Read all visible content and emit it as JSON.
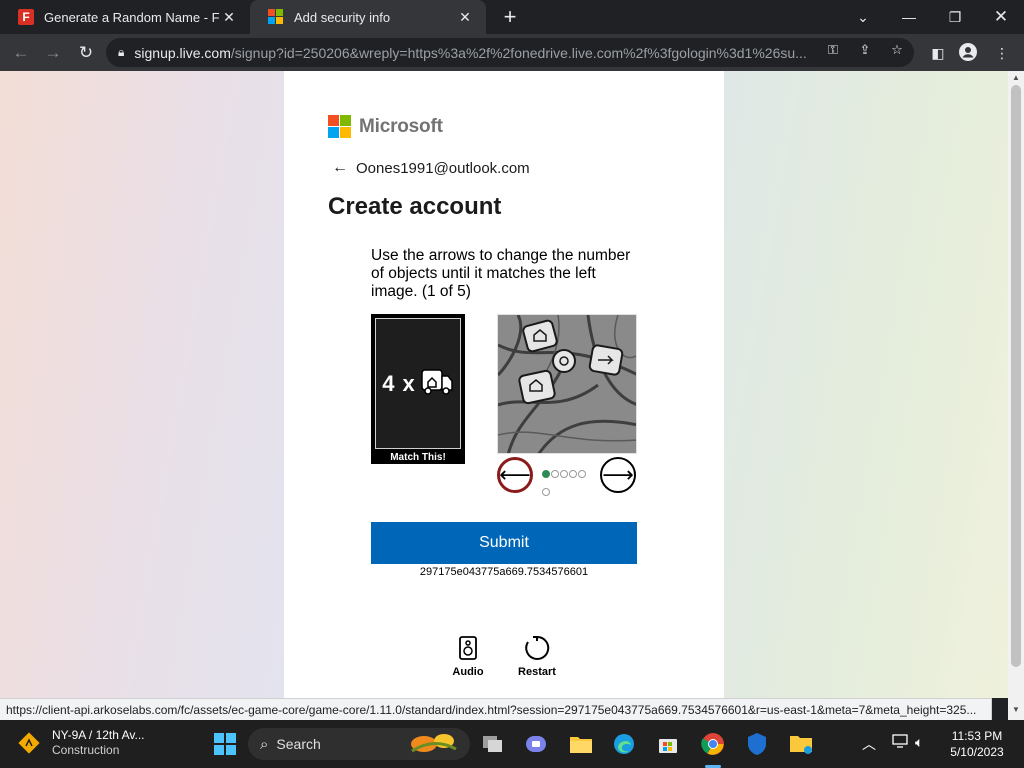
{
  "browser": {
    "tabs": [
      {
        "title": "Generate a Random Name - Fake",
        "favicon": "fakename-icon",
        "active": false
      },
      {
        "title": "Add security info",
        "favicon": "microsoft-icon",
        "active": true
      }
    ],
    "url_host": "signup.live.com",
    "url_path": "/signup?id=250206&wreply=https%3a%2f%2fonedrive.live.com%2f%3fgologin%3d1%26su..."
  },
  "page": {
    "brand": "Microsoft",
    "account_email": "Oones1991@outlook.com",
    "heading": "Create account",
    "puzzle": {
      "instructions": "Use the arrows to change the number of objects until it matches the left image. (1 of 5)",
      "target_quantity": "4 x",
      "target_caption": "Match This!",
      "selected_step": 1,
      "total_steps": 6
    },
    "submit_label": "Submit",
    "session_id": "297175e043775a669.7534576601",
    "audio_label": "Audio",
    "restart_label": "Restart"
  },
  "status_url": "https://client-api.arkoselabs.com/fc/assets/ec-game-core/game-core/1.11.0/standard/index.html?session=297175e043775a669.7534576601&r=us-east-1&meta=7&meta_height=325...",
  "taskbar": {
    "weather_title": "NY-9A / 12th Av...",
    "weather_subtitle": "Construction",
    "search_placeholder": "Search",
    "time": "11:53 PM",
    "date": "5/10/2023"
  },
  "colors": {
    "ms_red": "#f25022",
    "ms_green": "#7fba00",
    "ms_blue": "#00a4ef",
    "ms_yellow": "#ffb900",
    "submit_blue": "#0067b8"
  }
}
